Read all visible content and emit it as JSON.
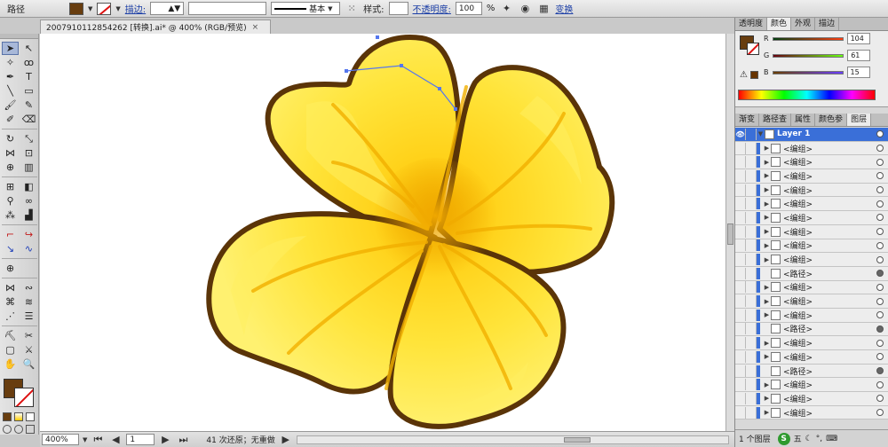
{
  "control_bar": {
    "selection_type": "路径",
    "stroke_label": "描边:",
    "stroke_style": "基本",
    "style_label": "样式:",
    "opacity_label": "不透明度:",
    "opacity_value": "100",
    "opacity_unit": "%",
    "transform_label": "变换"
  },
  "colors": {
    "fill": "#683D0F",
    "accent": "#3a6fd8"
  },
  "document": {
    "tab_title": "20079101128542​62 [转换].ai* @ 400% (RGB/预览)",
    "close_glyph": "×"
  },
  "status": {
    "zoom": "400%",
    "artboard": "1",
    "undo_info": "41 次还原；无重做"
  },
  "panels": {
    "top_tabs": [
      "透明度",
      "颜色",
      "外观",
      "描边"
    ],
    "active_top_tab": "颜色",
    "rgb": [
      {
        "channel": "R",
        "value": "104"
      },
      {
        "channel": "G",
        "value": "61"
      },
      {
        "channel": "B",
        "value": "15"
      }
    ],
    "bottom_tabs": [
      "渐变",
      "路径查",
      "属性",
      "颜色参",
      "图层"
    ],
    "active_bottom_tab": "图层",
    "layer_name": "Layer 1",
    "layers": [
      {
        "name": "<编组>",
        "expand": true
      },
      {
        "name": "<编组>",
        "expand": true
      },
      {
        "name": "<编组>",
        "expand": true
      },
      {
        "name": "<编组>",
        "expand": true
      },
      {
        "name": "<编组>",
        "expand": true
      },
      {
        "name": "<编组>",
        "expand": true
      },
      {
        "name": "<编组>",
        "expand": true
      },
      {
        "name": "<编组>",
        "expand": true
      },
      {
        "name": "<编组>",
        "expand": true
      },
      {
        "name": "<路径>",
        "expand": false
      },
      {
        "name": "<编组>",
        "expand": true
      },
      {
        "name": "<编组>",
        "expand": true
      },
      {
        "name": "<编组>",
        "expand": true
      },
      {
        "name": "<路径>",
        "expand": false
      },
      {
        "name": "<编组>",
        "expand": true
      },
      {
        "name": "<编组>",
        "expand": true
      },
      {
        "name": "<路径>",
        "expand": false
      },
      {
        "name": "<编组>",
        "expand": true
      },
      {
        "name": "<编组>",
        "expand": true
      },
      {
        "name": "<编组>",
        "expand": true
      }
    ],
    "footer": "1 个图层",
    "ime_label": "五"
  }
}
